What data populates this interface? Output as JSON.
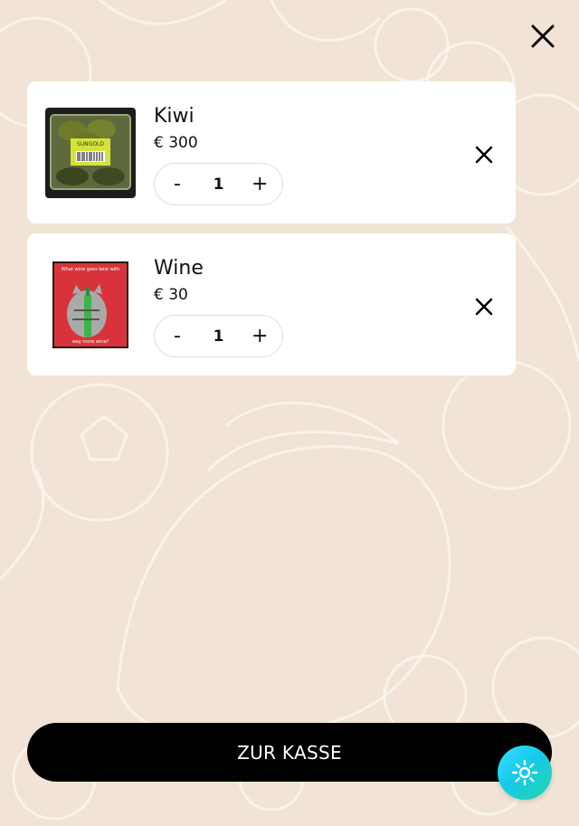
{
  "cart": {
    "items": [
      {
        "name": "Kiwi",
        "price": "€ 300",
        "quantity": "1",
        "minus": "-",
        "plus": "+"
      },
      {
        "name": "Wine",
        "price": "€ 30",
        "quantity": "1",
        "minus": "-",
        "plus": "+"
      }
    ],
    "checkout_label": "ZUR KASSE"
  },
  "thumbnails": {
    "kiwi_label": "SUNGOLD",
    "wine_text_top": "What wine goes best with",
    "wine_text_bottom": "way more wine?"
  },
  "colors": {
    "background": "#f1e4d6",
    "card": "#ffffff",
    "checkout_button": "#000000",
    "fab_gradient_start": "#35e0ff",
    "fab_gradient_end": "#1fd6a6"
  },
  "icons": {
    "close": "close-icon",
    "remove": "remove-item-icon",
    "theme": "sun-icon"
  }
}
